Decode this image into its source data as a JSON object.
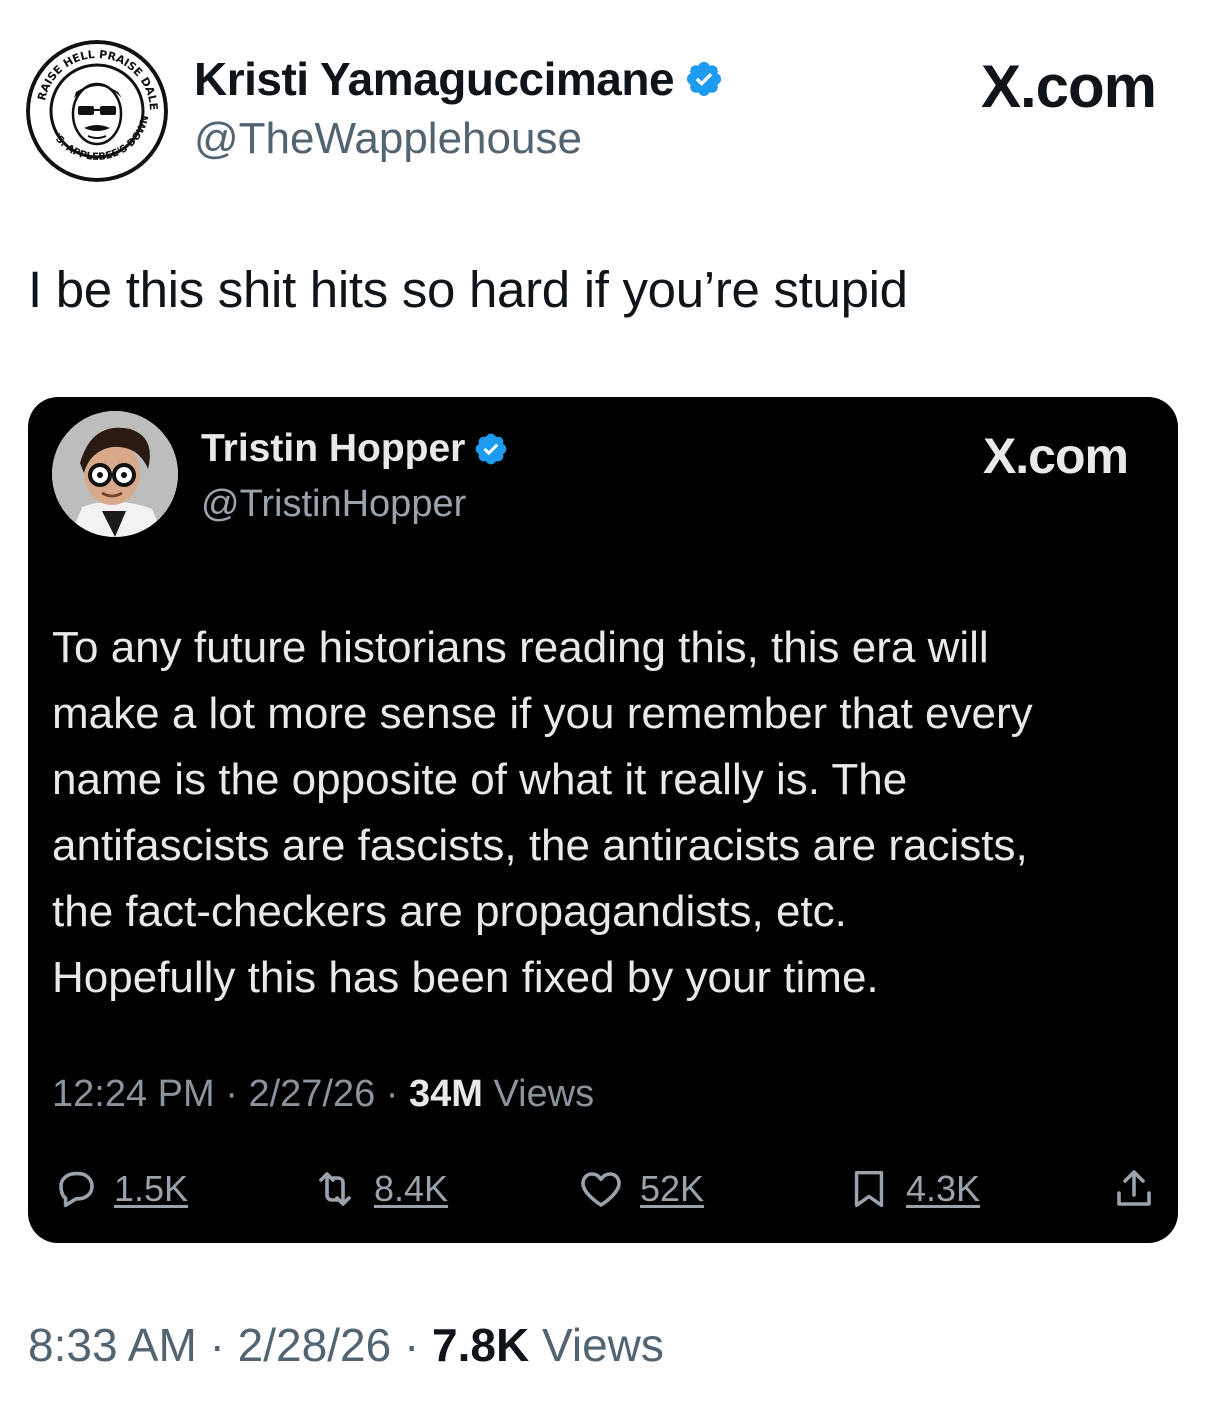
{
  "tweet": {
    "author": {
      "name": "Kristi Yamaguccimane",
      "handle": "@TheWapplehouse",
      "verified": true,
      "avatar_icon": "wapplehouse-seal-avatar",
      "avatar_seal_top": "HELL PRAISE",
      "avatar_seal_left": "RAISE",
      "avatar_seal_right": "DALE. BURN",
      "avatar_seal_bottom": "'S. APPLEBEE'S DOWN"
    },
    "site_label": "X.com",
    "text": "I be this shit hits so hard if you’re stupid",
    "time": "8:33 AM",
    "date": "2/28/26",
    "views_count": "7.8K",
    "views_label": "Views",
    "separator": "·"
  },
  "quoted": {
    "author": {
      "name": "Tristin Hopper",
      "handle": "@TristinHopper",
      "verified": true,
      "avatar_icon": "person-with-glasses-avatar"
    },
    "site_label": "X.com",
    "lines": [
      "To any future historians reading this, this era will",
      "make a lot more sense if you remember that every",
      "name is the opposite of what it really is. The",
      "antifascists are fascists, the antiracists are racists,",
      "the fact-checkers are propagandists, etc.",
      "Hopefully this has been fixed by your time."
    ],
    "time": "12:24 PM",
    "date": "2/27/26",
    "views_count": "34M",
    "views_label": "Views",
    "separator": "·",
    "actions": {
      "replies": "1.5K",
      "reposts": "8.4K",
      "likes": "52K",
      "bookmarks": "4.3K"
    }
  },
  "colors": {
    "verified_badge": "#1d9bf0",
    "card_background": "#000000",
    "primary_text": "#0f1419",
    "secondary_text": "#536471"
  }
}
